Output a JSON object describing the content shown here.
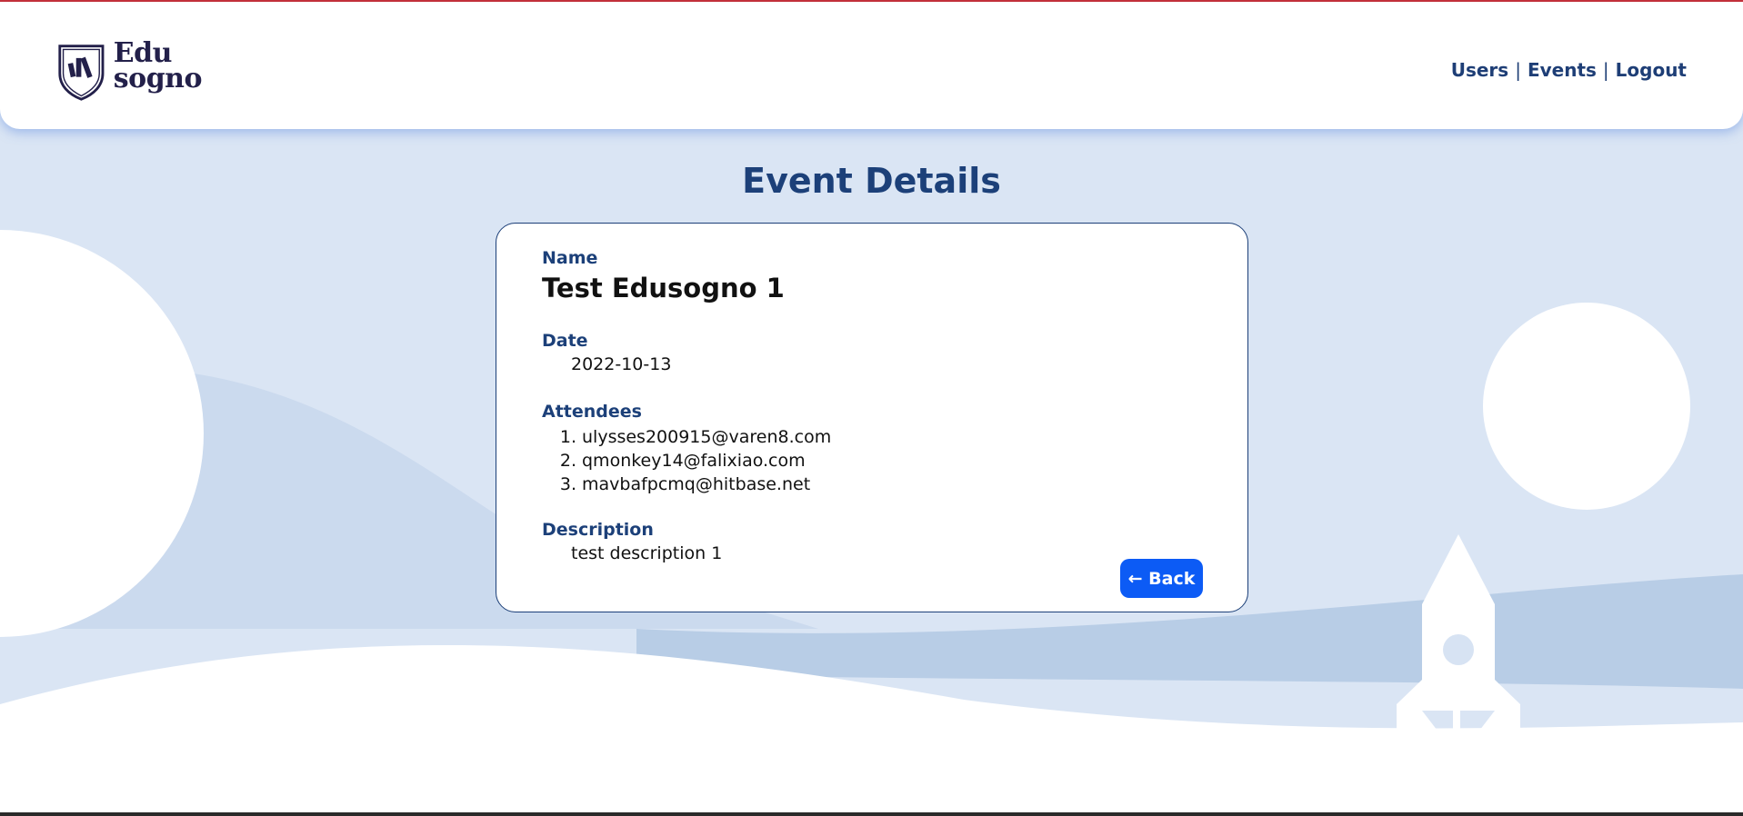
{
  "brand": {
    "logo_line1": "Edu",
    "logo_line2": "sogno"
  },
  "nav": {
    "users": "Users",
    "events": "Events",
    "logout": "Logout",
    "separator": "|"
  },
  "page": {
    "title": "Event Details"
  },
  "event": {
    "name_label": "Name",
    "name": "Test Edusogno 1",
    "date_label": "Date",
    "date": "2022-10-13",
    "attendees_label": "Attendees",
    "attendees": [
      {
        "num": "1.",
        "email": "ulysses200915@varen8.com"
      },
      {
        "num": "2.",
        "email": "qmonkey14@falixiao.com"
      },
      {
        "num": "3.",
        "email": "mavbafpcmq@hitbase.net"
      }
    ],
    "description_label": "Description",
    "description": "test description 1"
  },
  "actions": {
    "back": "← Back"
  },
  "colors": {
    "accent": "#0c5bf5",
    "heading": "#1c4079",
    "background": "#dae5f4",
    "top_border": "#c2303a"
  }
}
